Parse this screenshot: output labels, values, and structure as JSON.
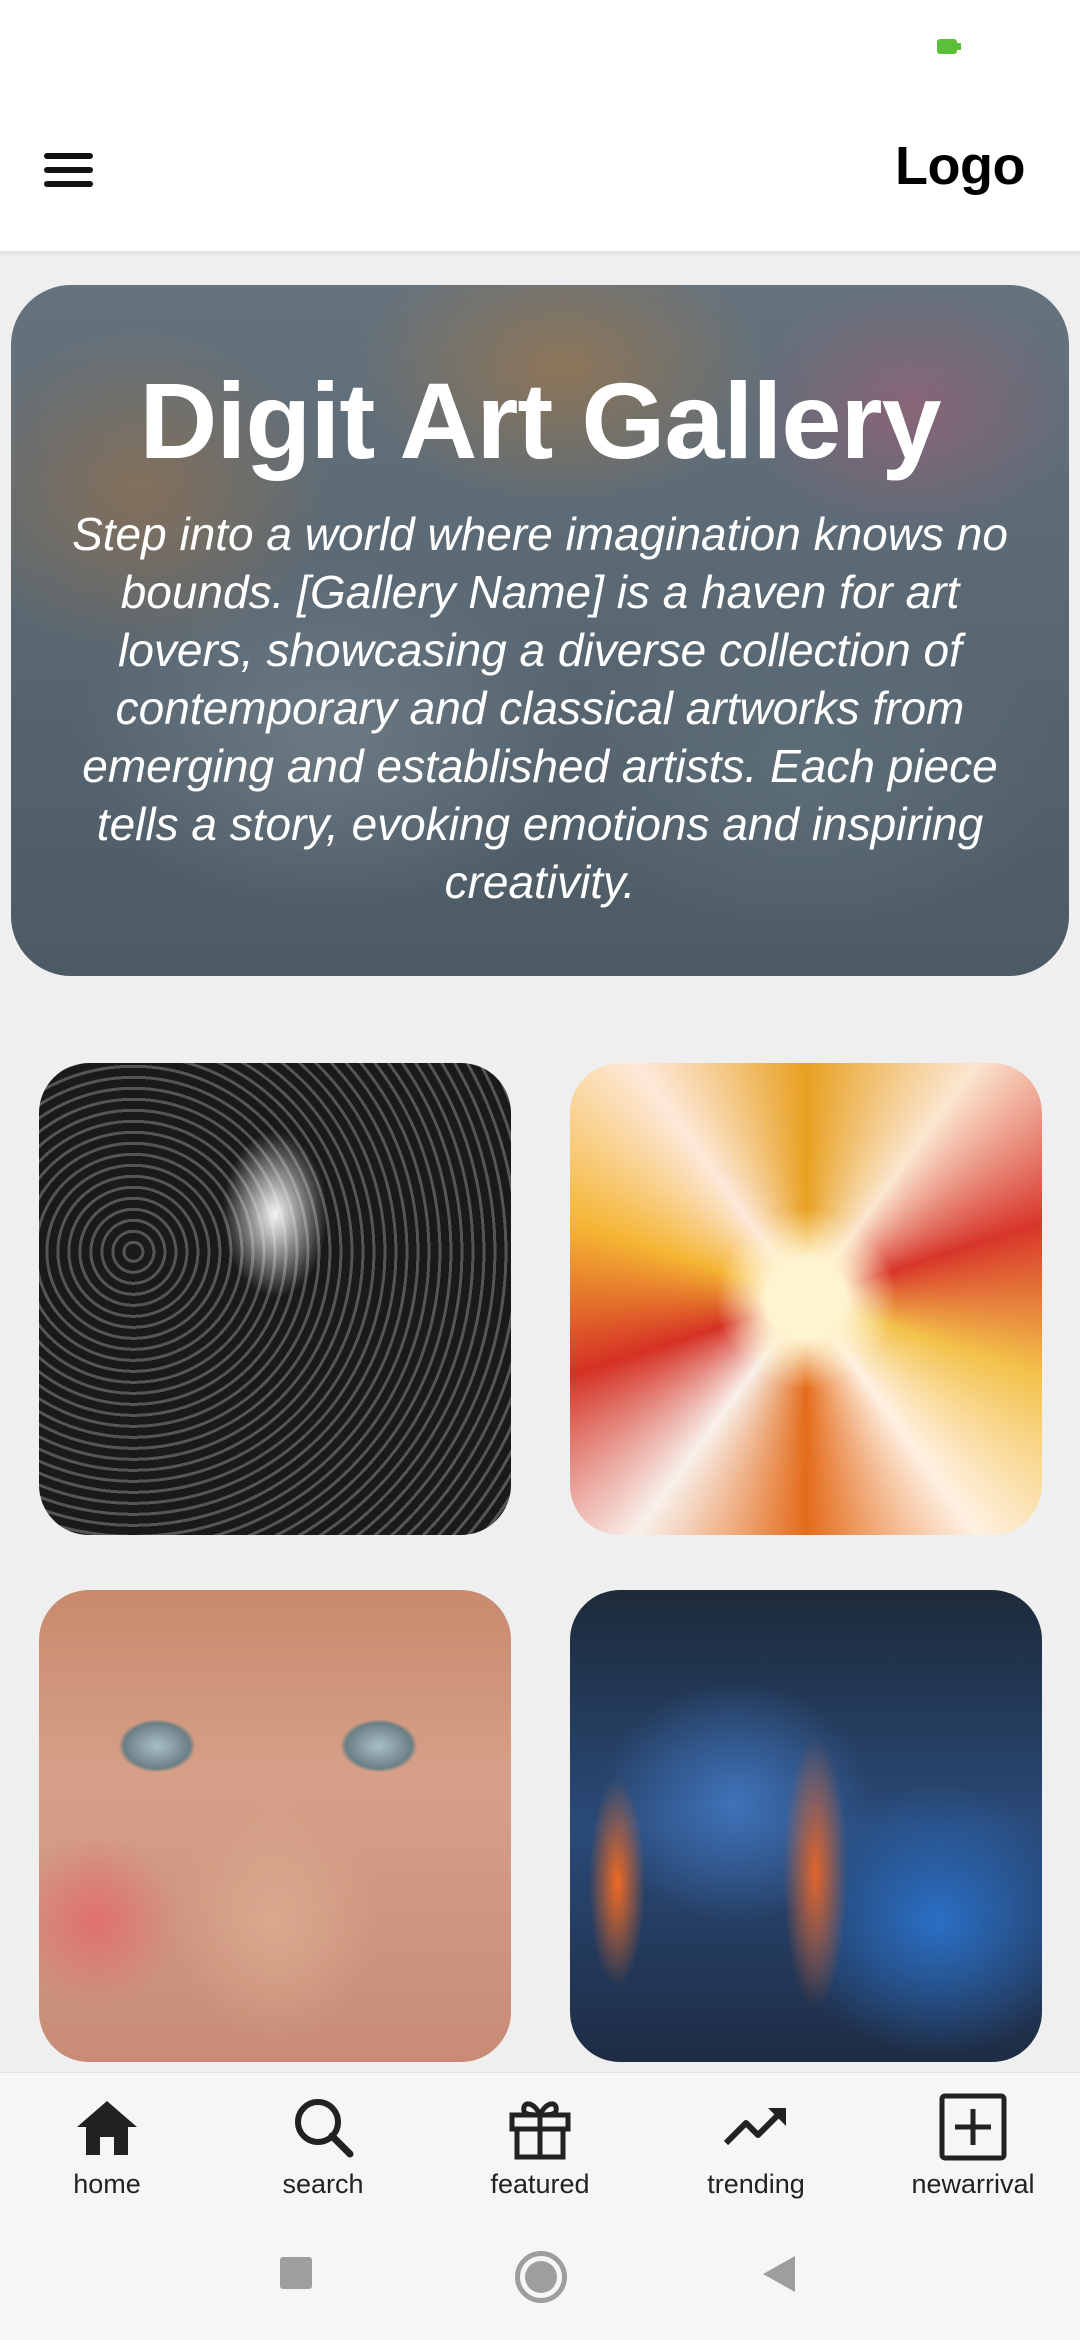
{
  "app_bar": {
    "title": "Logo",
    "menu_icon": "hamburger-menu-icon"
  },
  "hero": {
    "title": "Digit Art Gallery",
    "description": "Step into a world where imagination knows no bounds. [Gallery Name] is a haven for art lovers, showcasing a diverse collection of contemporary and classical artworks from emerging and established artists. Each piece tells a story, evoking emotions and inspiring creativity."
  },
  "gallery": {
    "items": [
      {
        "subject": "black-and-white sketch portrait of a woman"
      },
      {
        "subject": "orange, red and white abstract fluid burst"
      },
      {
        "subject": "colorful street-art face with blue eyes"
      },
      {
        "subject": "dark blue and orange abstract brush strokes"
      }
    ]
  },
  "bottom_nav": {
    "items": [
      {
        "label": "home",
        "icon": "home-icon"
      },
      {
        "label": "search",
        "icon": "search-icon"
      },
      {
        "label": "featured",
        "icon": "gift-icon"
      },
      {
        "label": "trending",
        "icon": "trending-up-icon"
      },
      {
        "label": "newarrival",
        "icon": "add-box-icon"
      }
    ]
  },
  "system_nav": {
    "buttons": [
      "recent-apps",
      "home",
      "back"
    ]
  },
  "colors": {
    "status_indicator": "#5bbf3a",
    "background": "#efeff0",
    "app_bar": "#ffffff",
    "nav_icon": "#222222",
    "system_nav_icon": "#9e9e9e"
  }
}
